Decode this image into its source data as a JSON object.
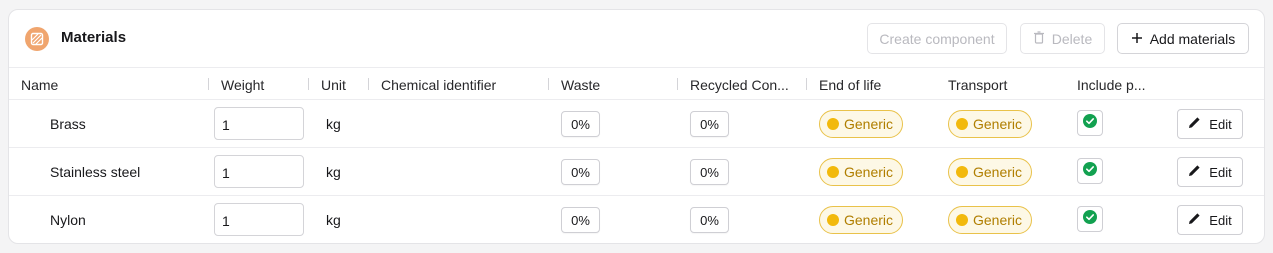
{
  "header": {
    "title": "Materials",
    "icon": "materials-icon",
    "buttons": {
      "create_component": "Create component",
      "delete": "Delete",
      "add_materials": "Add materials"
    }
  },
  "columns": [
    "Name",
    "Weight",
    "Unit",
    "Chemical identifier",
    "Waste",
    "Recycled Con...",
    "End of life",
    "Transport",
    "Include p..."
  ],
  "rows": [
    {
      "name": "Brass",
      "weight": "1",
      "unit": "kg",
      "chemical_identifier": "",
      "waste": "0%",
      "recycled": "0%",
      "end_of_life": "Generic",
      "transport": "Generic",
      "include": true,
      "edit_label": "Edit"
    },
    {
      "name": "Stainless steel",
      "weight": "1",
      "unit": "kg",
      "chemical_identifier": "",
      "waste": "0%",
      "recycled": "0%",
      "end_of_life": "Generic",
      "transport": "Generic",
      "include": true,
      "edit_label": "Edit"
    },
    {
      "name": "Nylon",
      "weight": "1",
      "unit": "kg",
      "chemical_identifier": "",
      "waste": "0%",
      "recycled": "0%",
      "end_of_life": "Generic",
      "transport": "Generic",
      "include": true,
      "edit_label": "Edit"
    }
  ],
  "colors": {
    "accent_icon": "#f0a56e",
    "badge_border": "#e9c24a",
    "badge_text": "#b07e00",
    "badge_dot": "#f2b90c",
    "check_green": "#12a150"
  }
}
